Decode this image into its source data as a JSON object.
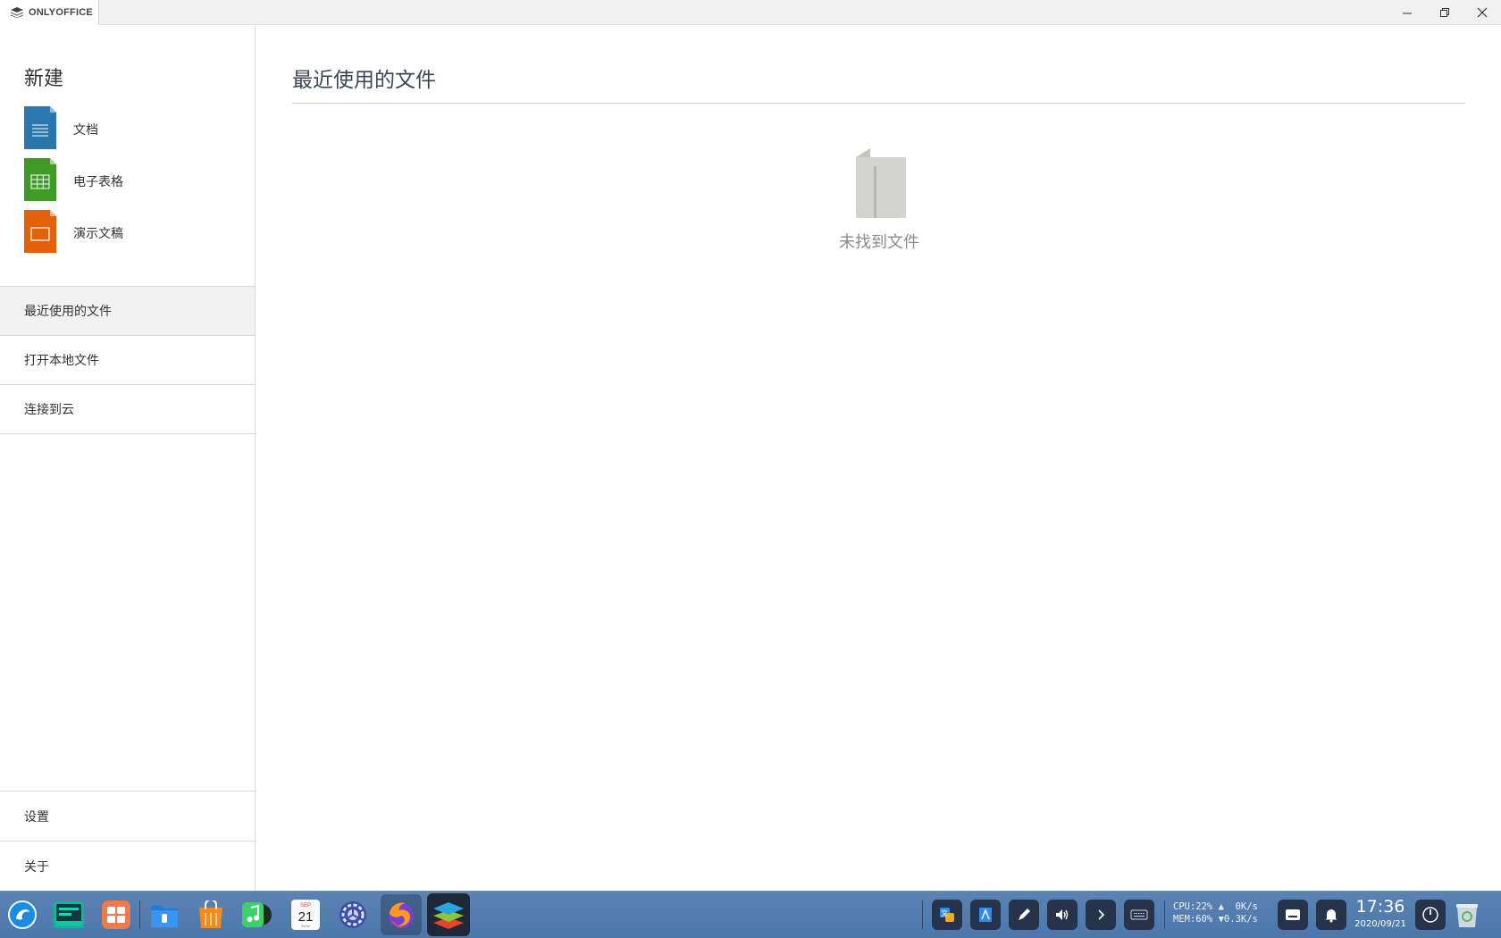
{
  "titlebar": {
    "brand": "ONLYOFFICE",
    "controls": [
      "minimize",
      "restore",
      "close"
    ]
  },
  "sidebar": {
    "new_title": "新建",
    "new_items": [
      {
        "label": "文档",
        "icon": "document-icon",
        "color": "#2a77ad"
      },
      {
        "label": "电子表格",
        "icon": "spreadsheet-icon",
        "color": "#3f9a26"
      },
      {
        "label": "演示文稿",
        "icon": "presentation-icon",
        "color": "#e2620c"
      }
    ],
    "nav": [
      {
        "label": "最近使用的文件",
        "active": true
      },
      {
        "label": "打开本地文件",
        "active": false
      },
      {
        "label": "连接到云",
        "active": false
      }
    ],
    "bottom_nav": [
      {
        "label": "设置"
      },
      {
        "label": "关于"
      }
    ]
  },
  "main": {
    "title": "最近使用的文件",
    "empty_message": "未找到文件"
  },
  "taskbar": {
    "apps": [
      "launcher-icon",
      "terminal-icon",
      "multitask-icon",
      "file-manager-icon",
      "app-store-icon",
      "music-icon",
      "calendar-icon",
      "settings-icon",
      "firefox-icon",
      "onlyoffice-icon"
    ],
    "calendar": {
      "month": "SEP",
      "day": "21",
      "weekday": "MON"
    },
    "sysmon": {
      "cpu": "CPU:22%",
      "mem": "MEM:60%",
      "up": "0K/s",
      "down": "0.3K/s"
    },
    "time": "17:36",
    "date": "2020/09/21"
  }
}
